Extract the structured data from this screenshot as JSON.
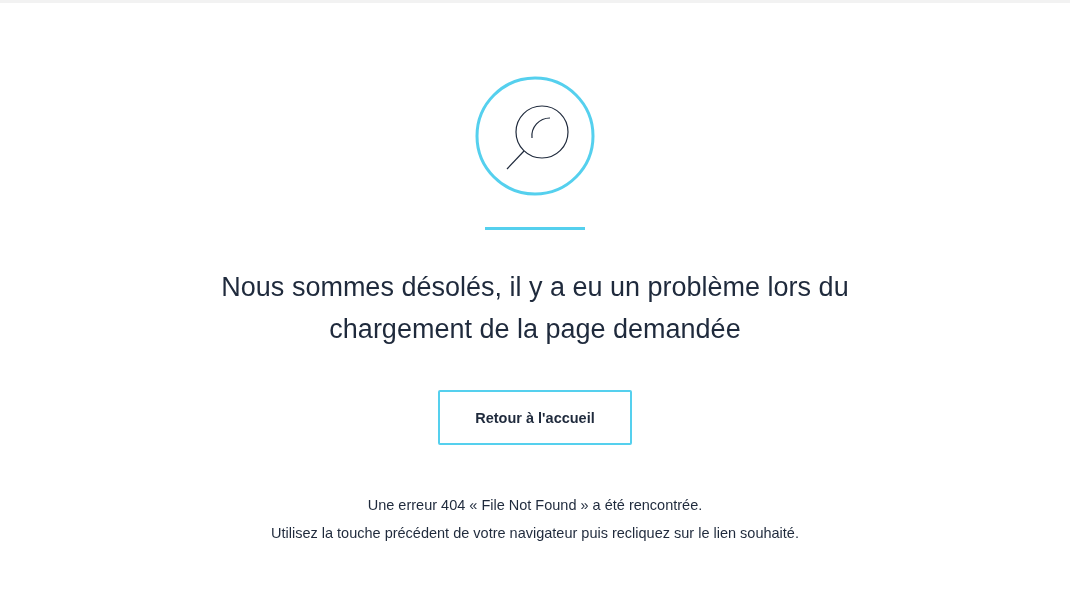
{
  "error_page": {
    "heading": "Nous sommes désolés, il y a eu un problème lors du chargement de la page demandée",
    "button": "Retour à l'accueil",
    "messages": [
      "Une erreur 404 « File Not Found » a été rencontrée.",
      "Utilisez la touche précédent de votre navigateur puis recliquez sur le lien souhaité."
    ]
  }
}
